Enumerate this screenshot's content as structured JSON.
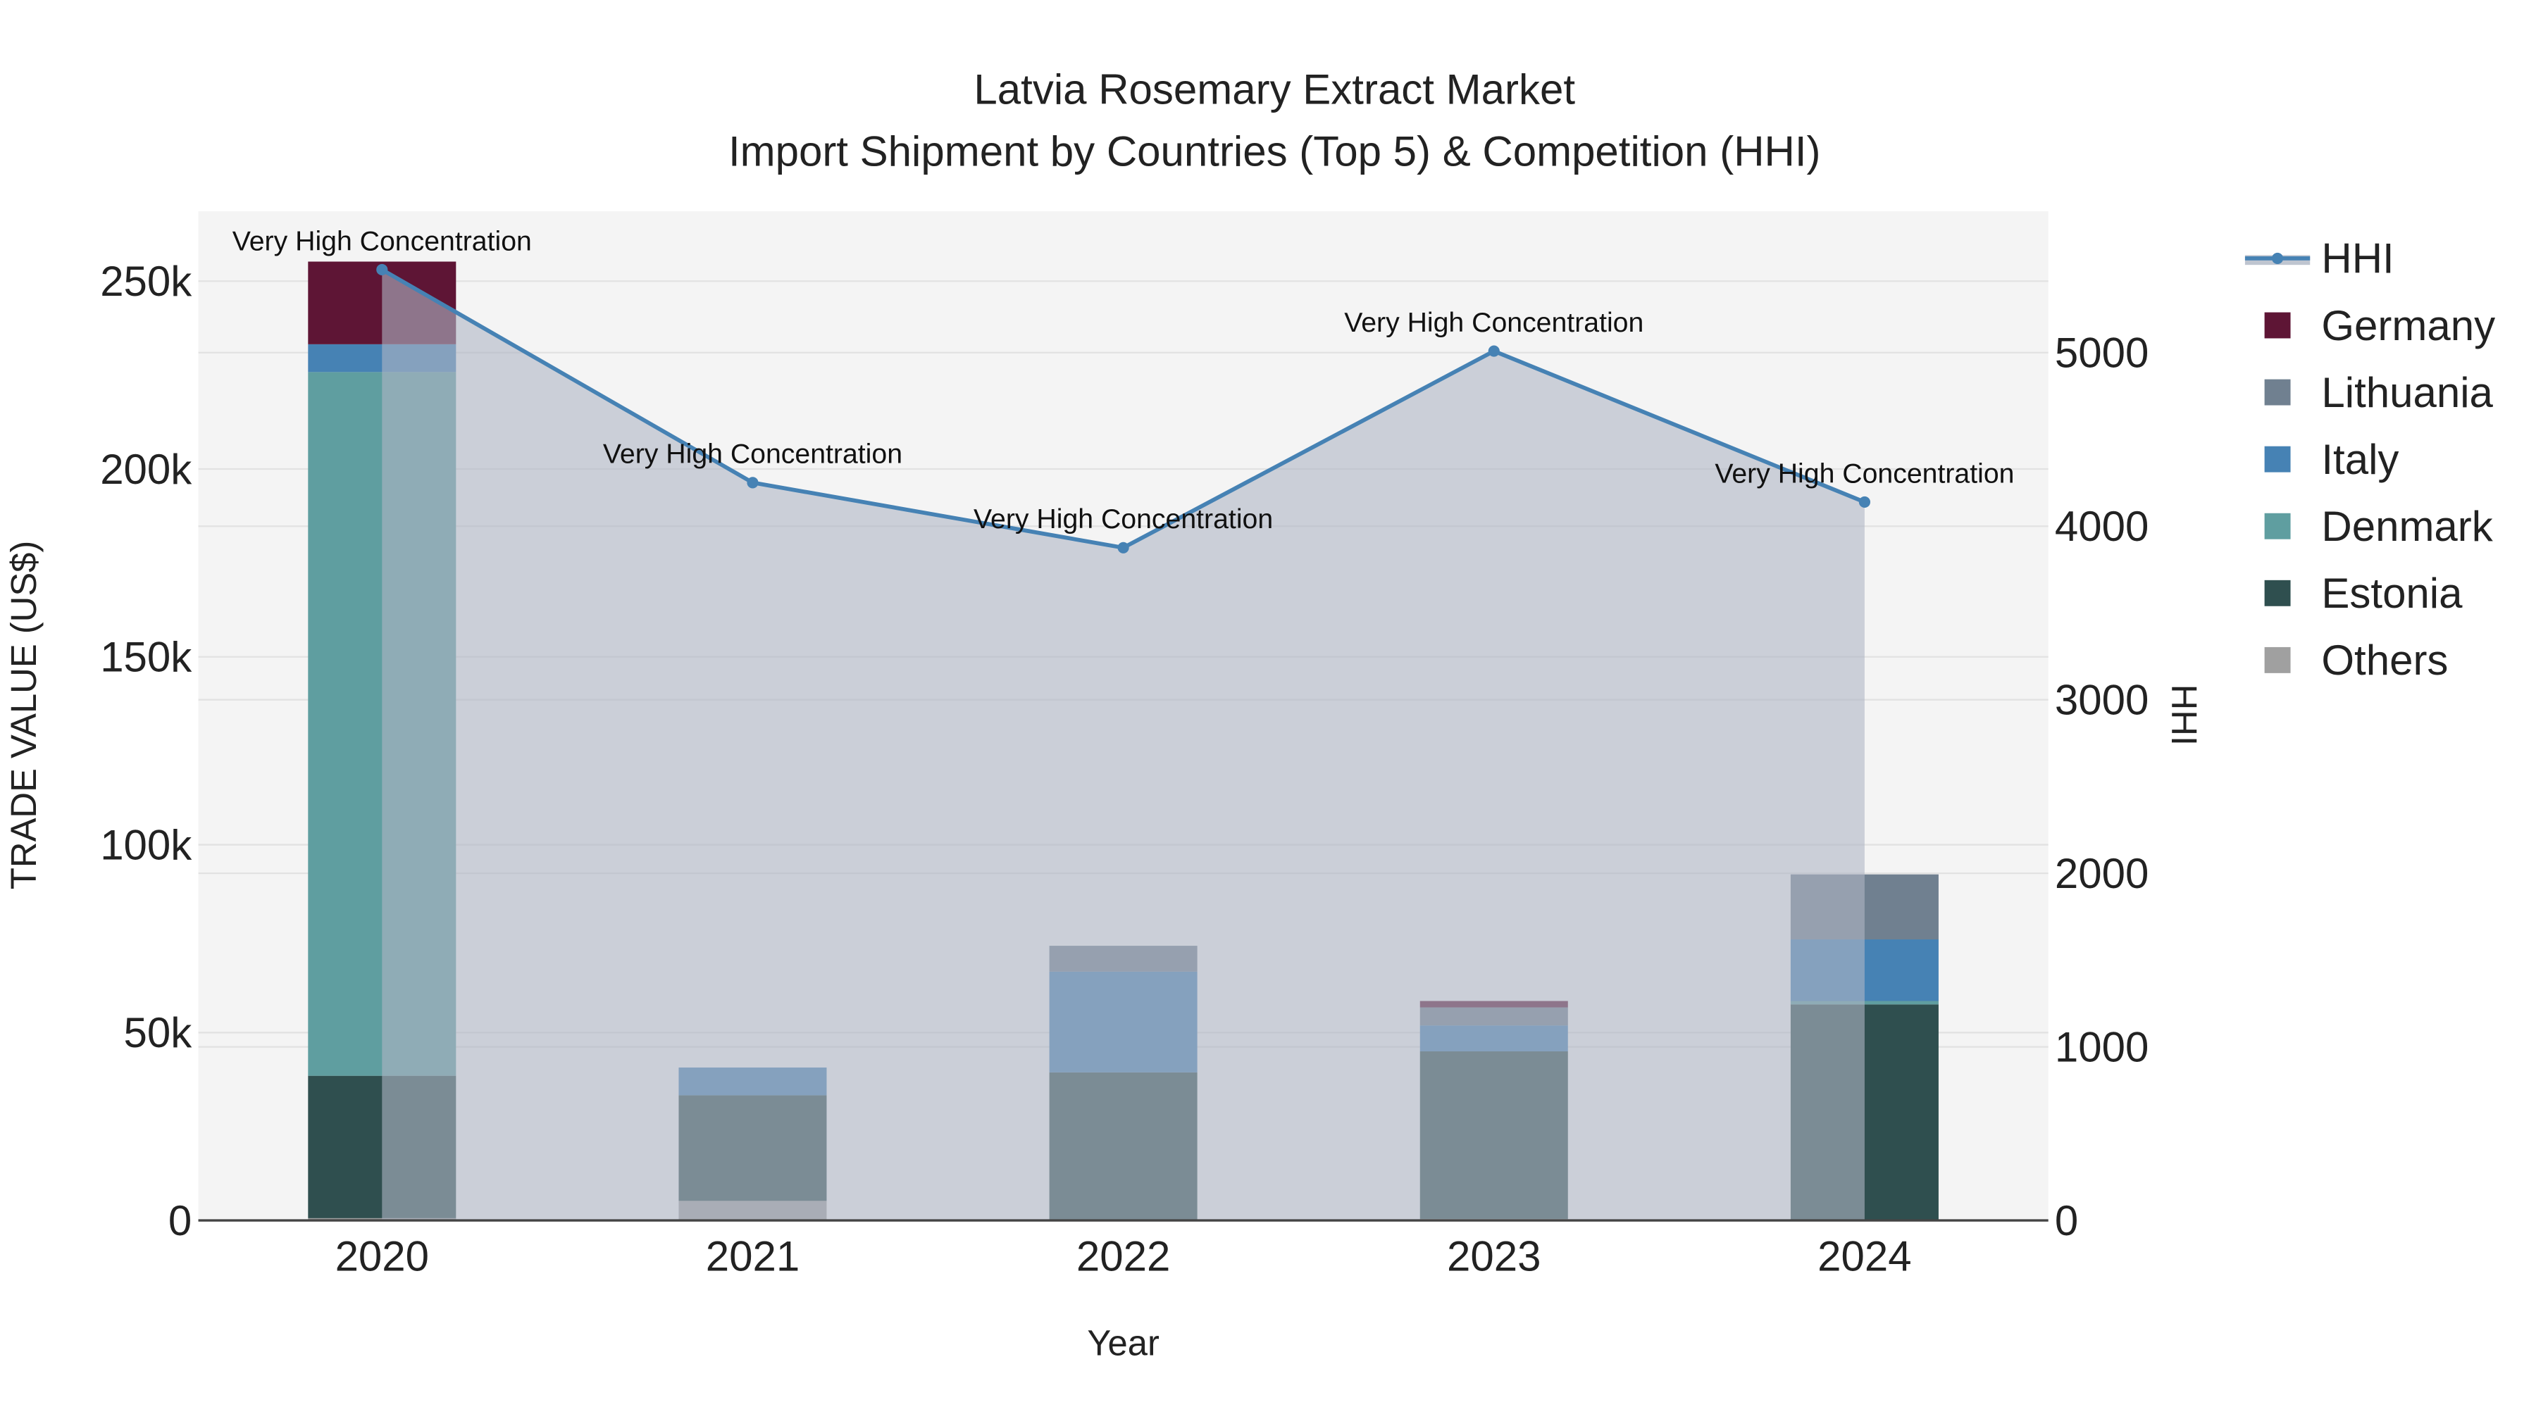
{
  "chart_data": {
    "type": "bar",
    "title": "Latvia Rosemary Extract Market",
    "subtitle": "Import Shipment by Countries (Top 5) & Competition (HHI)",
    "xlabel": "Year",
    "ylabel": "TRADE VALUE (US$)",
    "y2label": "HHI",
    "categories": [
      "2020",
      "2021",
      "2022",
      "2023",
      "2024"
    ],
    "ylim": [
      0,
      268000
    ],
    "y2lim": [
      0,
      5800
    ],
    "yticks": [
      0,
      50000,
      100000,
      150000,
      200000,
      250000
    ],
    "ytick_labels": [
      "0",
      "50k",
      "100k",
      "150k",
      "200k",
      "250k"
    ],
    "y2ticks": [
      0,
      1000,
      2000,
      3000,
      4000,
      5000
    ],
    "y2tick_labels": [
      "0",
      "1000",
      "2000",
      "3000",
      "4000",
      "5000"
    ],
    "series": [
      {
        "name": "Others",
        "color": "#a0a0a0",
        "values": [
          600,
          5200,
          0,
          400,
          0
        ]
      },
      {
        "name": "Estonia",
        "color": "#2f4f4f",
        "values": [
          37900,
          28100,
          39400,
          44600,
          57500
        ]
      },
      {
        "name": "Denmark",
        "color": "#5f9ea0",
        "values": [
          187300,
          0,
          0,
          0,
          900
        ]
      },
      {
        "name": "Italy",
        "color": "#4682b4",
        "values": [
          7400,
          7400,
          26800,
          6900,
          16400
        ]
      },
      {
        "name": "Lithuania",
        "color": "#708090",
        "values": [
          0,
          0,
          6900,
          4800,
          17300
        ]
      },
      {
        "name": "Germany",
        "color": "#5e1535",
        "values": [
          22000,
          0,
          0,
          1700,
          0
        ]
      }
    ],
    "legend_order": [
      "HHI",
      "Germany",
      "Lithuania",
      "Italy",
      "Denmark",
      "Estonia",
      "Others"
    ],
    "hhi": {
      "name": "HHI",
      "color": "#4682b4",
      "values": [
        5478,
        4251,
        3876,
        5009,
        4139
      ],
      "annotations": [
        "Very High Concentration",
        "Very High Concentration",
        "Very High Concentration",
        "Very High Concentration",
        "Very High Concentration"
      ]
    },
    "legend_position": "right",
    "grid": true
  }
}
